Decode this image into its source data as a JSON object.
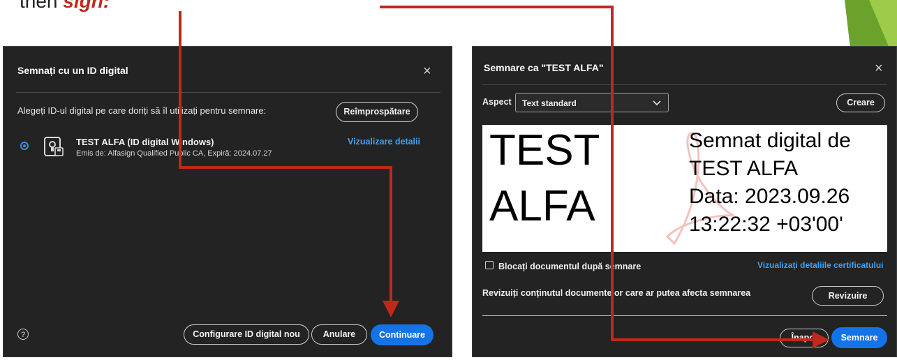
{
  "caption": {
    "prefix": "then ",
    "emphasis": "sign",
    "suffix": ":"
  },
  "left_dialog": {
    "title": "Semnați cu un ID digital",
    "close_glyph": "×",
    "prompt": "Alegeți ID-ul digital pe care doriți să îl utilizați pentru semnare:",
    "refresh_button": "Reîmprospătare",
    "id_item": {
      "name": "TEST ALFA (ID digital Windows)",
      "issuer": "Emis de: Alfasign Qualified Public CA, Expiră: 2024.07.27",
      "details_link": "Vizualizare detalii",
      "icon": "certificate-card-icon"
    },
    "help_glyph": "?",
    "configure_button": "Configurare ID digital nou",
    "cancel_button": "Anulare",
    "continue_button": "Continuare"
  },
  "right_dialog": {
    "title": "Semnare ca \"TEST ALFA\"",
    "close_glyph": "×",
    "aspect_label": "Aspect",
    "aspect_value": "Text standard",
    "create_button": "Creare",
    "preview": {
      "name_line1": "TEST",
      "name_line2": "ALFA",
      "info_line1": "Semnat digital de",
      "info_line2": "TEST ALFA",
      "info_line3": "Data: 2023.09.26",
      "info_line4": "13:22:32 +03'00'"
    },
    "lock_checkbox_label": "Blocați documentul după semnare",
    "certificate_link": "Vizualizați detaliile certificatului",
    "review_text": "Revizuiți conținutul documentelor care ar putea afecta semnarea",
    "review_button": "Revizuire",
    "back_button": "Înapoi",
    "sign_button": "Semnare"
  },
  "colors": {
    "dialog_bg": "#232323",
    "accent_blue": "#1473e6",
    "link_blue": "#3ea2f2",
    "arrow_red": "#c0281b",
    "deco_green": "#8cc43f"
  }
}
